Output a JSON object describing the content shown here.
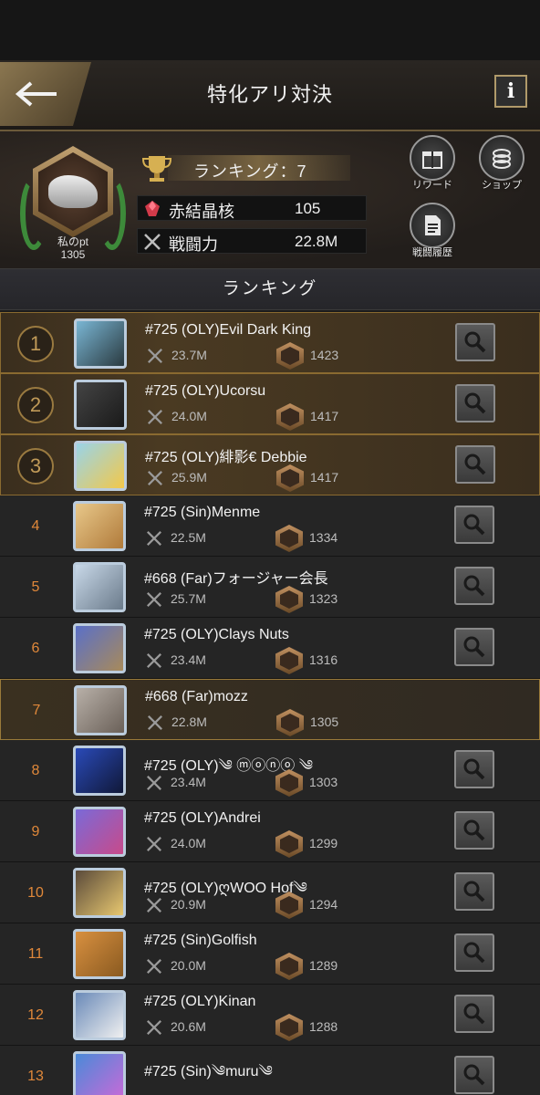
{
  "header": {
    "title": "特化アリ対決",
    "info_label": "i"
  },
  "profile": {
    "my_pt_label": "私のpt",
    "my_pt_value": "1305",
    "ranking_text": "ランキング：7",
    "stats": [
      {
        "label": "赤結晶核",
        "value": "105",
        "icon": "red-crystal-icon"
      },
      {
        "label": "戦闘力",
        "value": "22.8M",
        "icon": "crossed-swords-icon"
      }
    ],
    "buttons": [
      {
        "label": "リワード",
        "icon": "gift-icon"
      },
      {
        "label": "ショップ",
        "icon": "shop-icon"
      },
      {
        "label": "戦闘履歴",
        "icon": "document-icon"
      }
    ]
  },
  "section_title": "ランキング",
  "colors": {
    "accent": "#e0883a",
    "gold": "#9a7a40"
  },
  "rows": [
    {
      "rank": "1",
      "name": "#725 (OLY)Evil Dark King",
      "power": "23.7M",
      "pt": "1423",
      "thumb": [
        "#7ab6d4",
        "#2a3a40"
      ]
    },
    {
      "rank": "2",
      "name": "#725 (OLY)Ucorsu",
      "power": "24.0M",
      "pt": "1417",
      "thumb": [
        "#444",
        "#1a1a1a"
      ]
    },
    {
      "rank": "3",
      "name": "#725 (OLY)緋影€ Debbie",
      "power": "25.9M",
      "pt": "1417",
      "thumb": [
        "#9ad4e8",
        "#f2c84a"
      ]
    },
    {
      "rank": "4",
      "name": "#725 (Sin)Menme",
      "power": "22.5M",
      "pt": "1334",
      "thumb": [
        "#e8c88a",
        "#b07a3a"
      ]
    },
    {
      "rank": "5",
      "name": "#668 (Far)フォージャー会長",
      "power": "25.7M",
      "pt": "1323",
      "thumb": [
        "#c8d8e8",
        "#6a7a8a"
      ]
    },
    {
      "rank": "6",
      "name": "#725 (OLY)Clays Nuts",
      "power": "23.4M",
      "pt": "1316",
      "thumb": [
        "#5a70c8",
        "#a88a5a"
      ]
    },
    {
      "rank": "7",
      "name": "#668 (Far)mozz",
      "power": "22.8M",
      "pt": "1305",
      "thumb": [
        "#b8b0a8",
        "#6a6058"
      ]
    },
    {
      "rank": "8",
      "name": "#725 (OLY)༄ ⓜⓞⓝⓞ ༄",
      "power": "23.4M",
      "pt": "1303",
      "thumb": [
        "#2a4ab8",
        "#101838"
      ]
    },
    {
      "rank": "9",
      "name": "#725 (OLY)Andrei",
      "power": "24.0M",
      "pt": "1299",
      "thumb": [
        "#7a6ad8",
        "#c84a8a"
      ]
    },
    {
      "rank": "10",
      "name": "#725 (OLY)ღWOO Hof༄",
      "power": "20.9M",
      "pt": "1294",
      "thumb": [
        "#5a4a3a",
        "#e8c870"
      ]
    },
    {
      "rank": "11",
      "name": "#725 (Sin)Golfish",
      "power": "20.0M",
      "pt": "1289",
      "thumb": [
        "#d89040",
        "#8a5a20"
      ]
    },
    {
      "rank": "12",
      "name": "#725 (OLY)Kinan",
      "power": "20.6M",
      "pt": "1288",
      "thumb": [
        "#6a8ab8",
        "#f0f0f0"
      ]
    },
    {
      "rank": "13",
      "name": "#725 (Sin)༄muru༄",
      "power": "",
      "pt": "",
      "thumb": [
        "#4a8ad8",
        "#c86ad8"
      ]
    }
  ]
}
